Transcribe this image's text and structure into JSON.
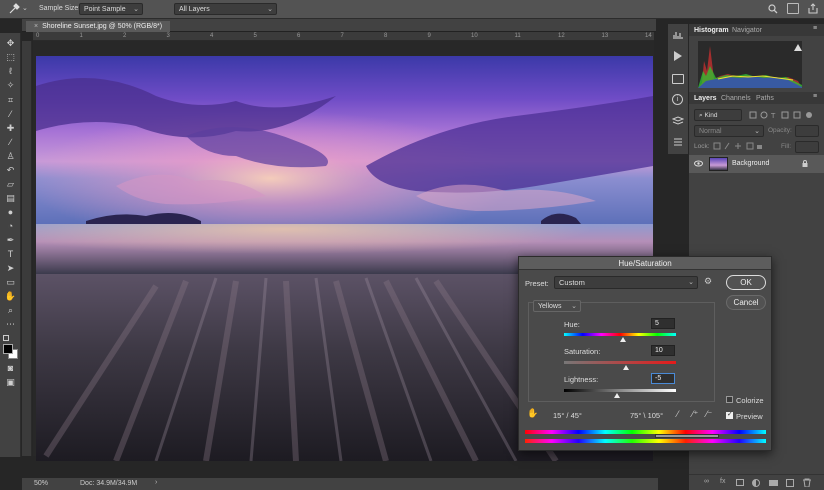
{
  "options_bar": {
    "tool_icon": "eyedropper-icon",
    "sample_size_label": "Sample Size:",
    "sample_size_value": "Point Sample",
    "sample_value": "All Layers"
  },
  "document": {
    "tab_title": "Shoreline Sunset.jpg @ 50% (RGB/8*)",
    "ruler_ticks": [
      "0",
      "1",
      "2",
      "3",
      "4",
      "5",
      "6",
      "7",
      "8",
      "9",
      "10",
      "11",
      "12",
      "13",
      "14"
    ]
  },
  "status_bar": {
    "zoom": "50%",
    "doc_size": "Doc: 34.9M/34.9M"
  },
  "tools": [
    "move-icon",
    "marquee-icon",
    "lasso-icon",
    "magic-wand-icon",
    "crop-icon",
    "eyedropper-icon",
    "healing-brush-icon",
    "brush-icon",
    "clone-stamp-icon",
    "history-brush-icon",
    "eraser-icon",
    "gradient-icon",
    "blur-icon",
    "dodge-icon",
    "pen-icon",
    "type-icon",
    "path-selection-icon",
    "shape-icon",
    "hand-icon",
    "zoom-icon",
    "more-tools-icon"
  ],
  "panels": {
    "histogram_tabs": [
      "Histogram",
      "Navigator"
    ],
    "layers_tabs": [
      "Layers",
      "Channels",
      "Paths"
    ],
    "kind_filter": "Kind",
    "blend_mode": "Normal",
    "opacity_label": "Opacity:",
    "lock_label": "Lock:",
    "fill_label": "Fill:",
    "layer_name": "Background"
  },
  "dialog": {
    "title": "Hue/Saturation",
    "preset_label": "Preset:",
    "preset_value": "Custom",
    "ok_label": "OK",
    "cancel_label": "Cancel",
    "channel": "Yellows",
    "hue_label": "Hue:",
    "hue_value": "5",
    "saturation_label": "Saturation:",
    "saturation_value": "10",
    "lightness_label": "Lightness:",
    "lightness_value": "-5",
    "colorize_label": "Colorize",
    "colorize_checked": false,
    "preview_label": "Preview",
    "preview_checked": true,
    "range_left": "15° / 45°",
    "range_right": "75° \\ 105°"
  },
  "colors": {
    "ui_bg": "#535353",
    "panel_bg": "#424242",
    "dialog_bg": "#4a4a4a",
    "accent_button": "#525252"
  }
}
